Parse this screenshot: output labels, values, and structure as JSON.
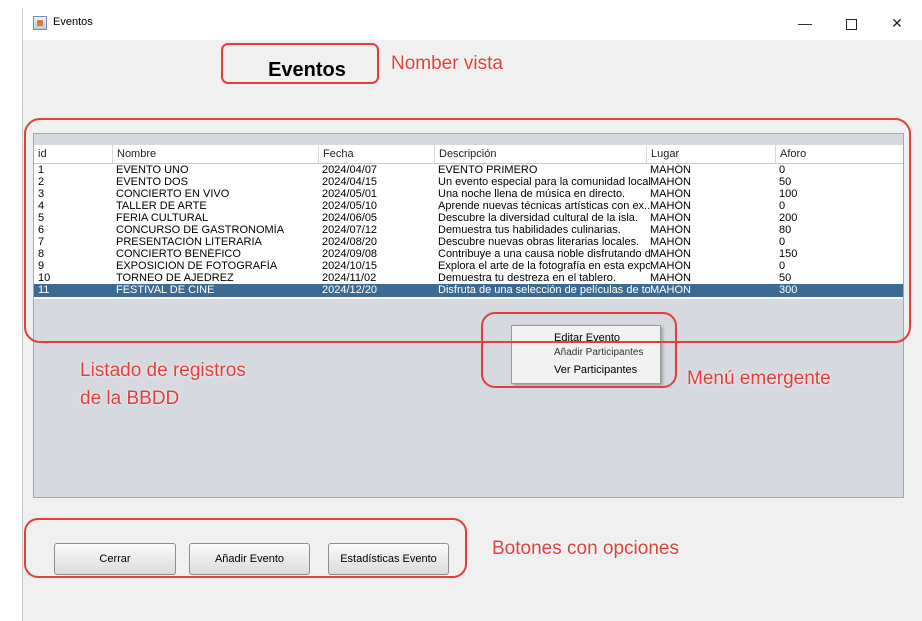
{
  "window": {
    "title": "Eventos"
  },
  "view_title": "Eventos",
  "table": {
    "columns": [
      "id",
      "Nombre",
      "Fecha",
      "Descripción",
      "Lugar",
      "Aforo"
    ],
    "rows": [
      [
        "1",
        "EVENTO UNO",
        "2024/04/07",
        "EVENTO PRIMERO",
        "MAHÓN",
        "0"
      ],
      [
        "2",
        "EVENTO DOS",
        "2024/04/15",
        "Un evento especial para la comunidad local.",
        "MAHÓN",
        "50"
      ],
      [
        "3",
        "CONCIERTO EN VIVO",
        "2024/05/01",
        "Una noche llena de música en directo.",
        "MAHÓN",
        "100"
      ],
      [
        "4",
        "TALLER DE ARTE",
        "2024/05/10",
        "Aprende nuevas técnicas artísticas con ex...",
        "MAHÓN",
        "0"
      ],
      [
        "5",
        "FERIA CULTURAL",
        "2024/06/05",
        "Descubre la diversidad cultural de la isla.",
        "MAHÓN",
        "200"
      ],
      [
        "6",
        "CONCURSO DE GASTRONOMÍA",
        "2024/07/12",
        "Demuestra tus habilidades culinarias.",
        "MAHÓN",
        "80"
      ],
      [
        "7",
        "PRESENTACIÓN LITERARIA",
        "2024/08/20",
        "Descubre nuevas obras literarias locales.",
        "MAHÓN",
        "0"
      ],
      [
        "8",
        "CONCIERTO BENÉFICO",
        "2024/09/08",
        "Contribuye a una causa noble disfrutando d...",
        "MAHÓN",
        "150"
      ],
      [
        "9",
        "EXPOSICIÓN DE FOTOGRAFÍA",
        "2024/10/15",
        "Explora el arte de la fotografía en esta expo...",
        "MAHÓN",
        "0"
      ],
      [
        "10",
        "TORNEO DE AJEDREZ",
        "2024/11/02",
        "Demuestra tu destreza en el tablero.",
        "MAHÓN",
        "50"
      ],
      [
        "11",
        "FESTIVAL DE CINE",
        "2024/12/20",
        "Disfruta de una selección de películas de to...",
        "MAHÓN",
        "300"
      ]
    ],
    "selected_index": 10
  },
  "popup_menu": {
    "items": [
      "Editar Evento",
      "Añadir Participantes",
      "Ver Participantes"
    ]
  },
  "buttons": {
    "close": "Cerrar",
    "add_event": "Añadir Evento",
    "stats": "Estadísticas Evento"
  },
  "annotations": {
    "view_name": "Nomber vista",
    "records_line1": "Listado de registros",
    "records_line2": "de la BBDD",
    "popup": "Menú emergente",
    "buttons": "Botones con opciones"
  },
  "colors": {
    "annotation": "#e0403b",
    "selected_row": "#3d6a93",
    "table_panel": "#d6d9df"
  }
}
